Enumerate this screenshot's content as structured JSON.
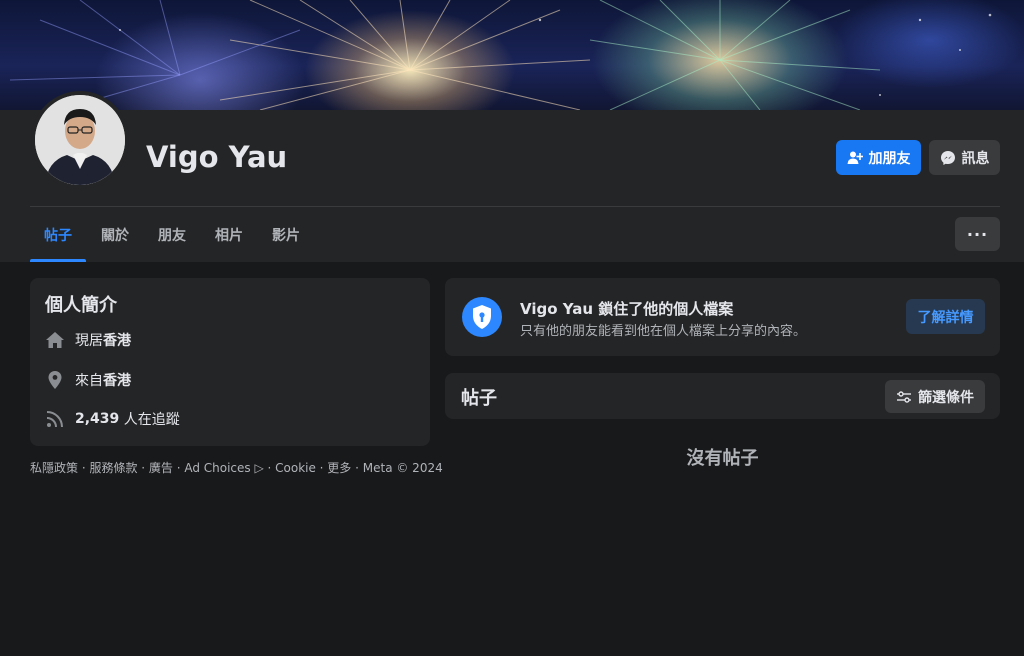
{
  "profile": {
    "name": "Vigo Yau",
    "add_friend_label": "加朋友",
    "message_label": "訊息"
  },
  "tabs": [
    {
      "label": "帖子",
      "active": true
    },
    {
      "label": "關於",
      "active": false
    },
    {
      "label": "朋友",
      "active": false
    },
    {
      "label": "相片",
      "active": false
    },
    {
      "label": "影片",
      "active": false
    }
  ],
  "more_label": "···",
  "intro": {
    "title": "個人簡介",
    "lives_prefix": "現居",
    "lives_place": "香港",
    "from_prefix": "來自",
    "from_place": "香港",
    "followers_count": "2,439",
    "followers_suffix": " 人在追蹤"
  },
  "footer": {
    "text": "私隱政策 · 服務條款 · 廣告 · Ad Choices ▷ · Cookie · 更多 · Meta © 2024"
  },
  "locked": {
    "title": "Vigo Yau 鎖住了他的個人檔案",
    "subtitle": "只有他的朋友能看到他在個人檔案上分享的內容。",
    "learn_more_label": "了解詳情"
  },
  "posts": {
    "title": "帖子",
    "filter_label": "篩選條件",
    "empty_label": "沒有帖子"
  },
  "colors": {
    "accent": "#1877f2",
    "background": "#18191a",
    "card": "#242526",
    "tab_active": "#2d88ff"
  }
}
